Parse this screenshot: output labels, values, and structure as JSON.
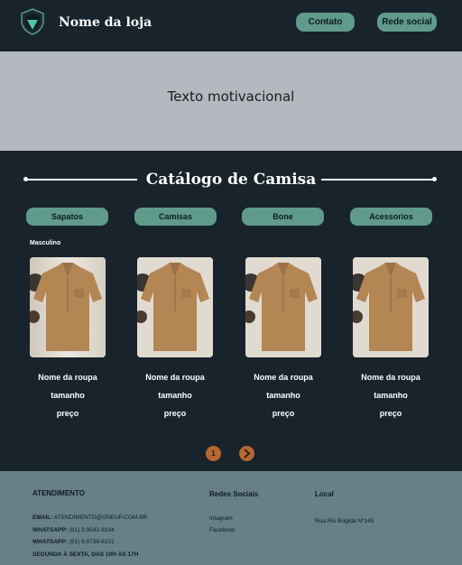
{
  "header": {
    "store_name": "Nome da loja",
    "contact_label": "Contato",
    "social_label": "Rede social"
  },
  "banner": {
    "text": "Texto motivacional"
  },
  "catalog": {
    "title": "Catálogo de Camisa",
    "categories": [
      "Sapatos",
      "Camisas",
      "Bone",
      "Acessorios"
    ],
    "subcategory": "Masculino",
    "products": [
      {
        "name": "Nome da roupa",
        "size": "tamanho",
        "price": "preço"
      },
      {
        "name": "Nome da roupa",
        "size": "tamanho",
        "price": "preço"
      },
      {
        "name": "Nome da roupa",
        "size": "tamanho",
        "price": "preço"
      },
      {
        "name": "Nome da roupa",
        "size": "tamanho",
        "price": "preço"
      }
    ],
    "pagination": {
      "current_page": "1",
      "next_icon": "chevron-right-icon"
    }
  },
  "footer": {
    "atendimento": {
      "title": "ATENDIMENTO",
      "email_label": "EMAIL:",
      "email": "ATENDIMENTO@ONEUP.COM.BR",
      "whatsapp_label": "WHATSAPP:",
      "whatsapp_1": "(81) 9.9541-8334",
      "whatsapp_2": "(81) 9.8739-6101",
      "hours": "SEGUNDA À SEXTA, DAS 10H ÀS 17H"
    },
    "social": {
      "title": "Redes Sociais",
      "links": [
        "Intagram",
        "Facebook"
      ]
    },
    "local": {
      "title": "Local",
      "address": "Rua Rio Brigida Nº145"
    }
  },
  "colors": {
    "background": "#18232b",
    "accent": "#5f9a8b",
    "banner": "#b3b9be",
    "footer": "#667f89",
    "pagination": "#b7672f"
  }
}
